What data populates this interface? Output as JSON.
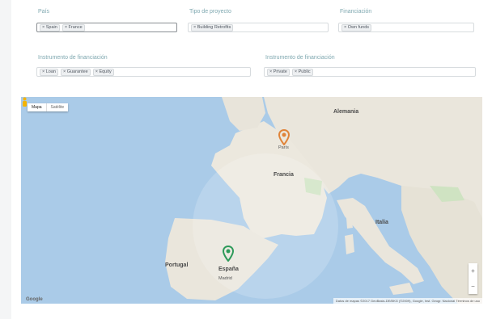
{
  "filters": {
    "pais": {
      "label": "País",
      "tags": [
        "Spain",
        "France"
      ]
    },
    "tipo_proyecto": {
      "label": "Tipo de proyecto",
      "tags": [
        "Building Retrofits"
      ]
    },
    "financiacion": {
      "label": "Financiación",
      "tags": [
        "Own funds"
      ]
    },
    "instrumento_financiacion": {
      "label": "Instrumento de financiación",
      "tags": [
        "Loan",
        "Guarantee",
        "Equity"
      ]
    },
    "instrumento_financiacion_2": {
      "label": "Instrumento de financiación",
      "tags": [
        "Private",
        "Public"
      ]
    }
  },
  "map": {
    "type_buttons": [
      "Mapa",
      "Satélite"
    ],
    "countries": {
      "germany": "Alemania",
      "france": "Francia",
      "spain": "España",
      "italy": "Italia",
      "portugal": "Portugal"
    },
    "cities": {
      "paris": "París",
      "madrid": "Madrid"
    },
    "zoom_in": "+",
    "zoom_out": "−",
    "logo": "Google",
    "attribution": "Datos de mapas ©2017 GeoBasis-DE/BKG (©2009), Google, Inst. Geogr. Nacional   Términos de uso"
  },
  "markers": [
    {
      "name": "France",
      "color": "#e0843a"
    },
    {
      "name": "Spain",
      "color": "#2e9a5a"
    }
  ]
}
